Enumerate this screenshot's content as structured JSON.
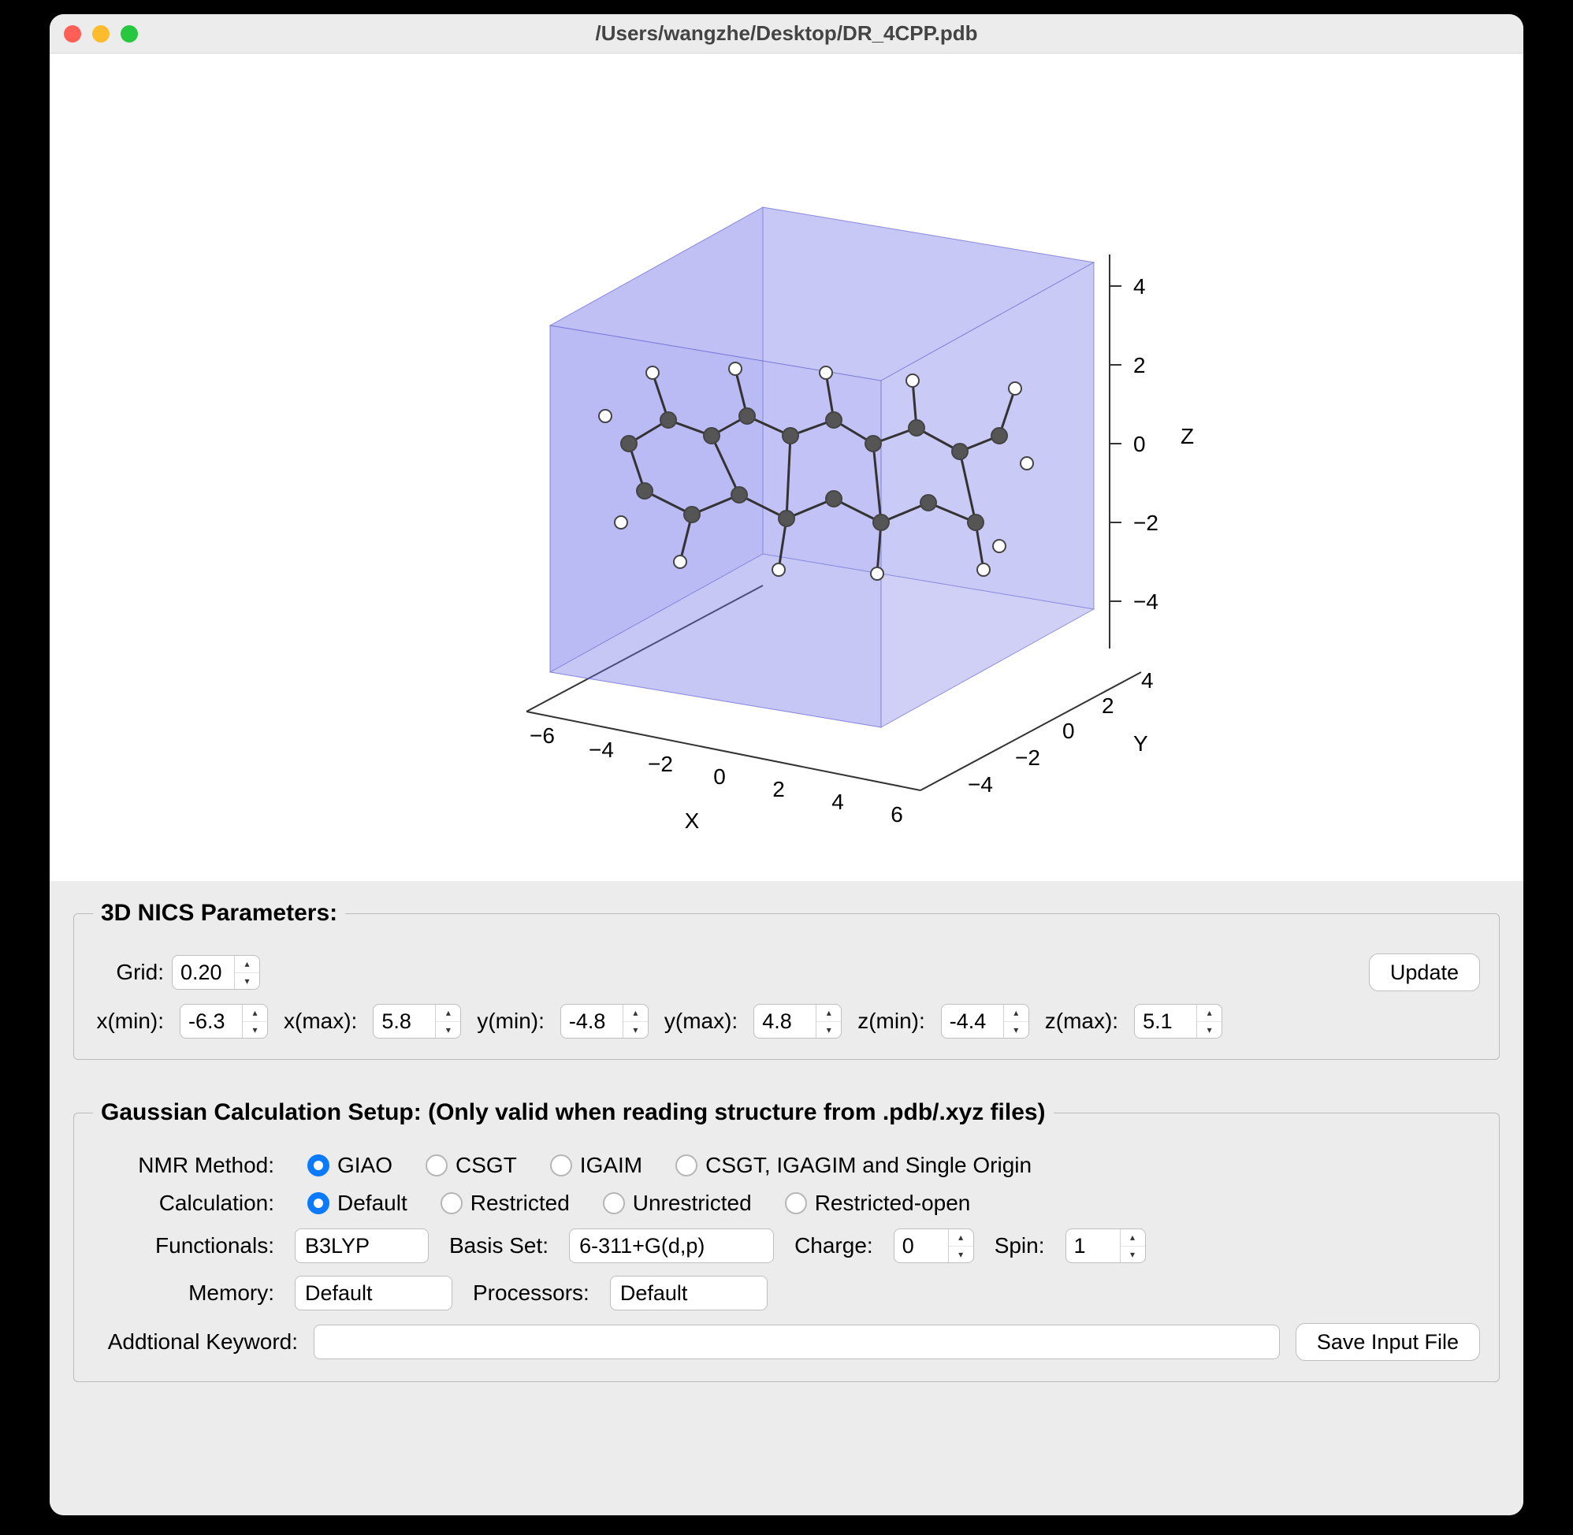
{
  "window": {
    "title": "/Users/wangzhe/Desktop/DR_4CPP.pdb"
  },
  "plot": {
    "x_label": "X",
    "y_label": "Y",
    "z_label": "Z",
    "x_ticks": [
      "−6",
      "−4",
      "−2",
      "0",
      "2",
      "4",
      "6"
    ],
    "y_ticks": [
      "−4",
      "−2",
      "0",
      "2",
      "4"
    ],
    "z_ticks": [
      "−4",
      "−2",
      "0",
      "2",
      "4"
    ]
  },
  "nics": {
    "legend": "3D NICS Parameters:",
    "grid_label": "Grid:",
    "grid_value": "0.20",
    "xmin_label": "x(min):",
    "xmin": "-6.3",
    "xmax_label": "x(max):",
    "xmax": "5.8",
    "ymin_label": "y(min):",
    "ymin": "-4.8",
    "ymax_label": "y(max):",
    "ymax": "4.8",
    "zmin_label": "z(min):",
    "zmin": "-4.4",
    "zmax_label": "z(max):",
    "zmax": "5.1",
    "update_label": "Update"
  },
  "gauss": {
    "legend": "Gaussian Calculation Setup: (Only valid when reading structure from .pdb/.xyz files)",
    "nmr_label": "NMR Method:",
    "nmr_options": {
      "giao": "GIAO",
      "csgt": "CSGT",
      "igaim": "IGAIM",
      "all": "CSGT, IGAGIM and Single Origin"
    },
    "calc_label": "Calculation:",
    "calc_options": {
      "default": "Default",
      "restricted": "Restricted",
      "unrestricted": "Unrestricted",
      "ropen": "Restricted-open"
    },
    "func_label": "Functionals:",
    "func_value": "B3LYP",
    "basis_label": "Basis Set:",
    "basis_value": "6-311+G(d,p)",
    "charge_label": "Charge:",
    "charge_value": "0",
    "spin_label": "Spin:",
    "spin_value": "1",
    "mem_label": "Memory:",
    "mem_value": "Default",
    "proc_label": "Processors:",
    "proc_value": "Default",
    "addkw_label": "Addtional Keyword:",
    "save_label": "Save Input File"
  }
}
